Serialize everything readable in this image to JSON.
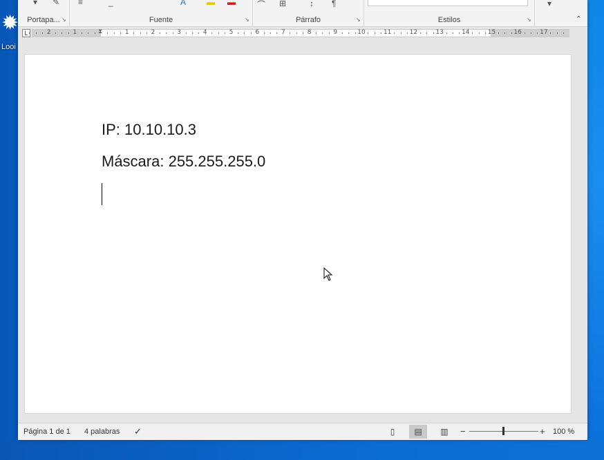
{
  "desktop": {
    "icon_label": "Looi"
  },
  "ribbon": {
    "groups": {
      "clipboard": "Portapa...",
      "font": "Fuente",
      "paragraph": "Párrafo",
      "styles": "Estilos"
    }
  },
  "ruler": {
    "ticks": [
      "2",
      "1",
      "1",
      "2",
      "3",
      "4",
      "5",
      "6",
      "7",
      "8",
      "9",
      "10",
      "11",
      "12",
      "13",
      "14",
      "15",
      "16",
      "17"
    ]
  },
  "document": {
    "lines": [
      "IP: 10.10.10.3",
      "Máscara: 255.255.255.0"
    ]
  },
  "status": {
    "page": "Página 1 de 1",
    "words": "4 palabras",
    "zoom_minus": "−",
    "zoom_plus": "+",
    "zoom": "100 %"
  },
  "colors": {
    "desktop_blue": "#0a63c9",
    "page_white": "#ffffff",
    "chrome_gray": "#e6e6e6"
  }
}
